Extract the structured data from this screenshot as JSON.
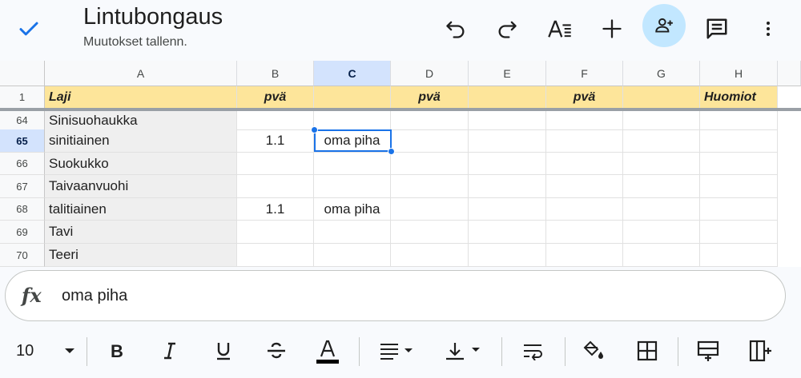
{
  "header": {
    "title": "Lintubongaus",
    "status": "Muutokset tallenn."
  },
  "icons": {
    "done": "check-icon",
    "undo": "undo-icon",
    "redo": "redo-icon",
    "text_format": "text-format-icon",
    "insert": "plus-icon",
    "share": "person-add-icon",
    "comment": "comment-icon",
    "more": "more-vert-icon"
  },
  "columns": [
    "A",
    "B",
    "C",
    "D",
    "E",
    "F",
    "G",
    "H"
  ],
  "selected_column": "C",
  "header_row": {
    "number": "1",
    "cells": [
      "Laji",
      "pvä",
      "",
      "pvä",
      "",
      "pvä",
      "",
      "Huomiot"
    ]
  },
  "rows": [
    {
      "number": "64",
      "cells": [
        "Sinisuohaukka",
        "",
        "",
        "",
        "",
        "",
        "",
        ""
      ]
    },
    {
      "number": "65",
      "cells": [
        "sinitiainen",
        "1.1",
        "oma piha",
        "",
        "",
        "",
        "",
        ""
      ]
    },
    {
      "number": "66",
      "cells": [
        "Suokukko",
        "",
        "",
        "",
        "",
        "",
        "",
        ""
      ]
    },
    {
      "number": "67",
      "cells": [
        "Taivaanvuohi",
        "",
        "",
        "",
        "",
        "",
        "",
        ""
      ]
    },
    {
      "number": "68",
      "cells": [
        "talitiainen",
        "1.1",
        "oma piha",
        "",
        "",
        "",
        "",
        ""
      ]
    },
    {
      "number": "69",
      "cells": [
        "Tavi",
        "",
        "",
        "",
        "",
        "",
        "",
        ""
      ]
    },
    {
      "number": "70",
      "cells": [
        "Teeri",
        "",
        "",
        "",
        "",
        "",
        "",
        ""
      ]
    }
  ],
  "selected_row": "65",
  "formula_bar": {
    "icon": "fx",
    "value": "oma piha"
  },
  "format_toolbar": {
    "font_size": "10",
    "text_color": "#000000"
  },
  "colors": {
    "accent": "#1a73e8",
    "header_fill": "#fde59a",
    "share_fill": "#c2e7ff"
  }
}
